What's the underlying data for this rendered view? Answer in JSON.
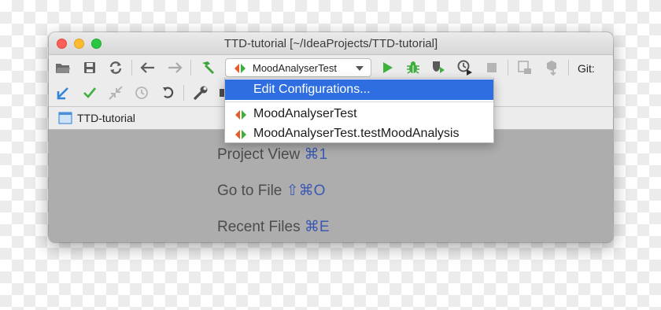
{
  "window": {
    "title": "TTD-tutorial [~/IdeaProjects/TTD-tutorial]"
  },
  "toolbar": {
    "row1_icons": [
      "open-folder-icon",
      "save-icon",
      "sync-icon",
      "back-icon",
      "forward-icon",
      "build-hammer-icon",
      "run-icon",
      "debug-icon",
      "coverage-icon",
      "profile-icon",
      "stop-icon",
      "project-structure-icon",
      "sdk-icon"
    ],
    "row2_icons": [
      "vcs-update-icon",
      "vcs-commit-icon",
      "vcs-compare-icon",
      "history-icon",
      "revert-icon",
      "settings-wrench-icon",
      "terminal-icon"
    ],
    "run_config": "MoodAnalyserTest",
    "git_label": "Git:"
  },
  "navbar": {
    "project": "TTD-tutorial"
  },
  "hints": [
    {
      "label": "Project View",
      "shortcut": "⌘1"
    },
    {
      "label": "Go to File",
      "shortcut": "⇧⌘O"
    },
    {
      "label": "Recent Files",
      "shortcut": "⌘E"
    }
  ],
  "popup": {
    "items": [
      {
        "label": "Edit Configurations...",
        "selected": true
      },
      {
        "label": "MoodAnalyserTest",
        "selected": false
      },
      {
        "label": "MoodAnalyserTest.testMoodAnalysis",
        "selected": false
      }
    ]
  },
  "colors": {
    "accent": "#2e6ee0",
    "run_green": "#3fb13d",
    "hint_key": "#3b59b4"
  }
}
